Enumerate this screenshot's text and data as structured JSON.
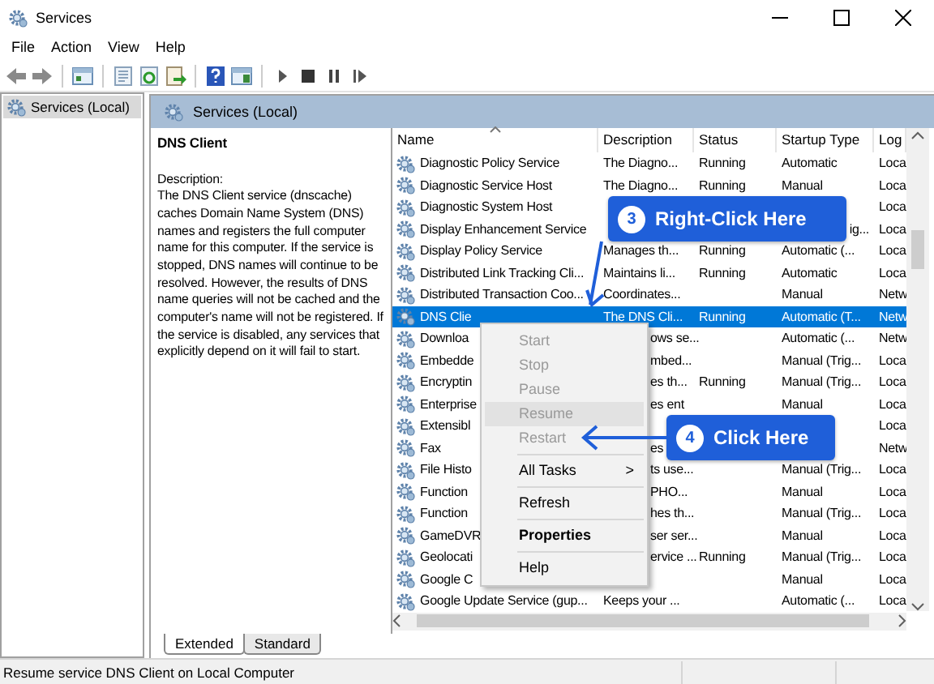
{
  "window": {
    "title": "Services"
  },
  "menu": [
    "File",
    "Action",
    "View",
    "Help"
  ],
  "tree": {
    "items": [
      {
        "label": "Services (Local)",
        "selected": true
      }
    ]
  },
  "panel_header": "Services (Local)",
  "detail": {
    "name": "DNS Client",
    "description_label": "Description:",
    "description": "The DNS Client service (dnscache) caches Domain Name System (DNS) names and registers the full computer name for this computer. If the service is stopped, DNS names will continue to be resolved. However, the results of DNS name queries will not be cached and the computer's name will not be registered. If the service is disabled, any services that explicitly depend on it will fail to start."
  },
  "table": {
    "columns": [
      "Name",
      "Description",
      "Status",
      "Startup Type",
      "Log"
    ],
    "rows": [
      {
        "name": "Diagnostic Policy Service",
        "description": "The Diagno...",
        "status": "Running",
        "startup": "Automatic",
        "logon": "Loca",
        "selected": false
      },
      {
        "name": "Diagnostic Service Host",
        "description": "The Diagno...",
        "status": "Running",
        "startup": "Manual",
        "logon": "Loca",
        "selected": false
      },
      {
        "name": "Diagnostic System Host",
        "logon": "Loca",
        "selected": false
      },
      {
        "name": "Display Enhancement Service",
        "startup": "ig...",
        "logon": "Loca",
        "selected": false,
        "startup_cut": true
      },
      {
        "name": "Display Policy Service",
        "description": "Manages th...",
        "status": "Running",
        "startup": "Automatic (...",
        "logon": "Loca",
        "selected": false
      },
      {
        "name": "Distributed Link Tracking Cli...",
        "description": "Maintains li...",
        "status": "Running",
        "startup": "Automatic",
        "logon": "Loca",
        "selected": false
      },
      {
        "name": "Distributed Transaction Coo...",
        "description": "Coordinates...",
        "startup": "Manual",
        "logon": "Netw",
        "selected": false
      },
      {
        "name": "DNS Clie",
        "description": "The DNS Cli...",
        "status": "Running",
        "startup": "Automatic (T...",
        "logon": "Netw",
        "selected": true
      },
      {
        "name": "Downloa",
        "description": "ows se...",
        "startup": "Automatic (...",
        "logon": "Netw",
        "selected": false,
        "description_cut": true
      },
      {
        "name": "Embedde",
        "description": "mbed...",
        "startup": "Manual (Trig...",
        "logon": "Loca",
        "selected": false,
        "description_cut": true
      },
      {
        "name": "Encryptin",
        "description": "es th...",
        "status": "Running",
        "startup": "Manual (Trig...",
        "logon": "Loca",
        "selected": false,
        "description_cut": true
      },
      {
        "name": "Enterprise",
        "description": "es ent",
        "startup": "Manual",
        "logon": "Loca",
        "selected": false,
        "description_cut": true
      },
      {
        "name": "Extensibl",
        "logon": "Loca",
        "selected": false
      },
      {
        "name": "Fax",
        "description": "es",
        "logon": "Netw",
        "selected": false,
        "description_cut": true
      },
      {
        "name": "File Histo",
        "description": "ts use...",
        "startup": "Manual (Trig...",
        "logon": "Loca",
        "selected": false,
        "description_cut": true
      },
      {
        "name": "Function",
        "description": "PHO...",
        "startup": "Manual",
        "logon": "Loca",
        "selected": false,
        "description_cut": true
      },
      {
        "name": "Function",
        "description": "hes th...",
        "startup": "Manual (Trig...",
        "logon": "Loca",
        "selected": false,
        "description_cut": true
      },
      {
        "name": "GameDVR",
        "description": "ser ser...",
        "startup": "Manual",
        "logon": "Loca",
        "selected": false,
        "description_cut": true
      },
      {
        "name": "Geolocati",
        "description": "ervice ...",
        "status": "Running",
        "startup": "Manual (Trig...",
        "logon": "Loca",
        "selected": false,
        "description_cut": true
      },
      {
        "name": "Google C",
        "startup": "Manual",
        "logon": "Loca",
        "selected": false
      },
      {
        "name": "Google Update Service (gup...",
        "description": "Keeps your ...",
        "startup": "Automatic (...",
        "logon": "Loca",
        "selected": false
      }
    ]
  },
  "context_menu": {
    "items": [
      {
        "kind": "item",
        "label": "Start",
        "disabled": true,
        "highlighted": false,
        "default": false
      },
      {
        "kind": "item",
        "label": "Stop",
        "disabled": true,
        "highlighted": false,
        "default": false
      },
      {
        "kind": "item",
        "label": "Pause",
        "disabled": true,
        "highlighted": false,
        "default": false
      },
      {
        "kind": "item",
        "label": "Resume",
        "disabled": true,
        "highlighted": true,
        "default": false
      },
      {
        "kind": "item",
        "label": "Restart",
        "disabled": true,
        "highlighted": false,
        "default": false
      },
      {
        "kind": "separator"
      },
      {
        "kind": "submenu",
        "label": "All Tasks",
        "arrow": ">",
        "disabled": false,
        "highlighted": false,
        "default": false
      },
      {
        "kind": "separator"
      },
      {
        "kind": "item",
        "label": "Refresh",
        "disabled": false,
        "highlighted": false,
        "default": false
      },
      {
        "kind": "separator"
      },
      {
        "kind": "item",
        "label": "Properties",
        "disabled": false,
        "highlighted": false,
        "default": true
      },
      {
        "kind": "separator"
      },
      {
        "kind": "item",
        "label": "Help",
        "disabled": false,
        "highlighted": false,
        "default": false
      }
    ]
  },
  "callouts": [
    {
      "number": "3",
      "text": "Right-Click Here"
    },
    {
      "number": "4",
      "text": "Click Here"
    }
  ],
  "view_tabs": [
    {
      "label": "Extended",
      "selected": true
    },
    {
      "label": "Standard",
      "selected": false
    }
  ],
  "status_bar": {
    "text": "Resume service DNS Client on Local Computer"
  }
}
